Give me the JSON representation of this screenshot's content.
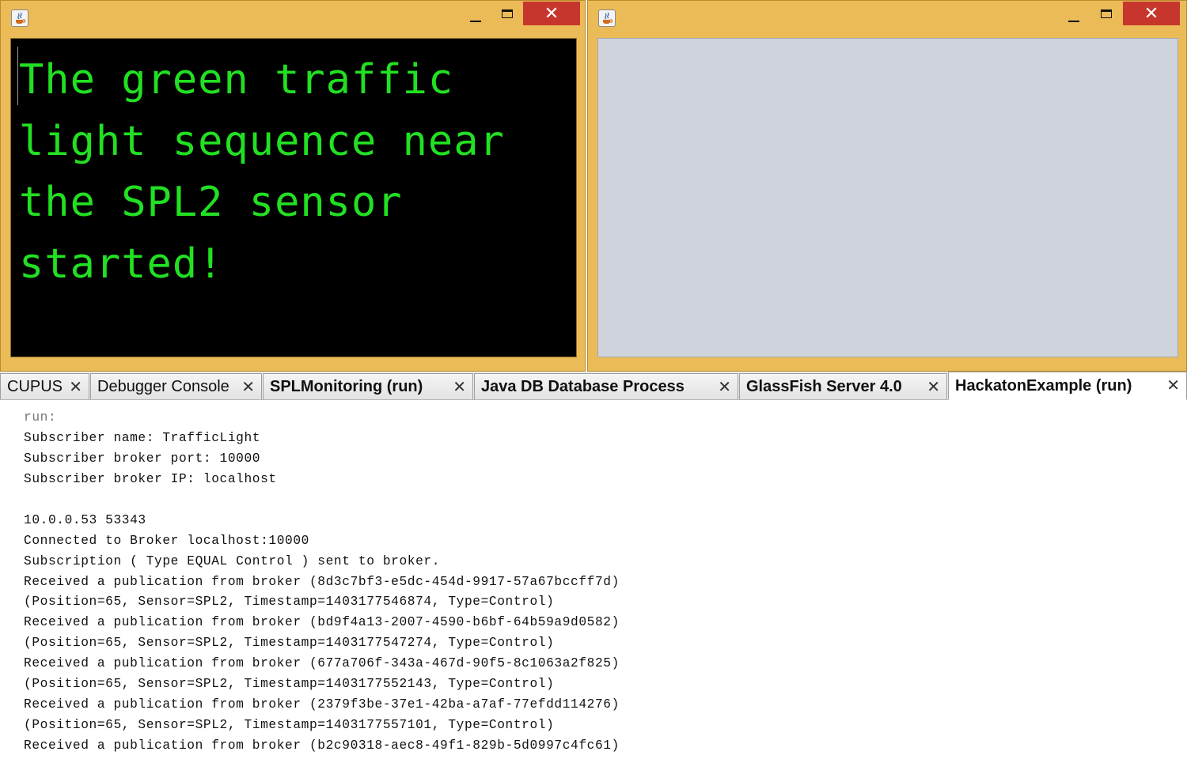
{
  "left_window": {
    "content_text": "The green traffic light sequence near the SPL2 sensor started!",
    "close_glyph": "✕"
  },
  "right_window": {
    "close_glyph": "✕"
  },
  "tabs": [
    {
      "label": "CUPUS",
      "bold": false,
      "active": false
    },
    {
      "label": "Debugger Console",
      "bold": false,
      "active": false
    },
    {
      "label": "SPLMonitoring (run)",
      "bold": true,
      "active": false
    },
    {
      "label": "Java DB Database Process",
      "bold": true,
      "active": false
    },
    {
      "label": "GlassFish Server 4.0",
      "bold": true,
      "active": false
    },
    {
      "label": "HackatonExample (run)",
      "bold": true,
      "active": true
    }
  ],
  "tab_close_glyph": "✕",
  "console": {
    "lines": [
      "run:",
      "Subscriber name: TrafficLight",
      "Subscriber broker port: 10000",
      "Subscriber broker IP: localhost",
      "",
      "10.0.0.53 53343",
      "Connected to Broker localhost:10000",
      "Subscription ( Type EQUAL Control ) sent to broker.",
      "Received a publication from broker (8d3c7bf3-e5dc-454d-9917-57a67bccff7d)",
      "(Position=65, Sensor=SPL2, Timestamp=1403177546874, Type=Control)",
      "Received a publication from broker (bd9f4a13-2007-4590-b6bf-64b59a9d0582)",
      "(Position=65, Sensor=SPL2, Timestamp=1403177547274, Type=Control)",
      "Received a publication from broker (677a706f-343a-467d-90f5-8c1063a2f825)",
      "(Position=65, Sensor=SPL2, Timestamp=1403177552143, Type=Control)",
      "Received a publication from broker (2379f3be-37e1-42ba-a7af-77efdd114276)",
      "(Position=65, Sensor=SPL2, Timestamp=1403177557101, Type=Control)",
      "Received a publication from broker (b2c90318-aec8-49f1-829b-5d0997c4fc61)"
    ]
  },
  "colors": {
    "window_frame": "#ebbb58",
    "close_button": "#c7362d",
    "terminal_bg": "#000000",
    "terminal_text": "#22e022",
    "right_panel_bg": "#cfd3db"
  }
}
